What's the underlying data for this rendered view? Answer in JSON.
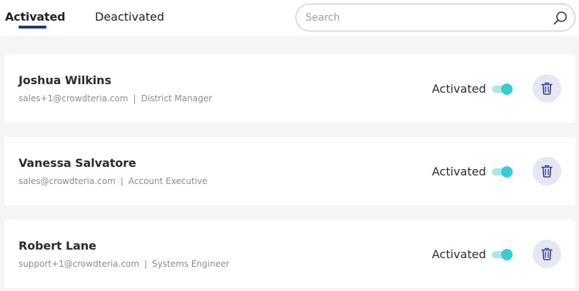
{
  "tabs": {
    "activated": "Activated",
    "deactivated": "Deactivated"
  },
  "search": {
    "placeholder": "Search",
    "value": ""
  },
  "users": [
    {
      "name": "Joshua Wilkins",
      "email": "sales+1@crowdteria.com",
      "role": "District Manager",
      "status": "Activated",
      "active": true
    },
    {
      "name": "Vanessa Salvatore",
      "email": "sales@crowdteria.com",
      "role": "Account Executive",
      "status": "Activated",
      "active": true
    },
    {
      "name": "Robert Lane",
      "email": "support+1@crowdteria.com",
      "role": "Systems Engineer",
      "status": "Activated",
      "active": true
    }
  ],
  "separator": "|",
  "icons": {
    "search": "search-icon",
    "delete": "trash-icon"
  },
  "colors": {
    "tab_underline": "#1f3a7a",
    "toggle_knob": "#3ccbd3",
    "toggle_track": "#a9e8ea",
    "delete_bg": "#e6e7f0",
    "delete_icon": "#2f3f86",
    "list_bg": "#f5f5f7"
  }
}
